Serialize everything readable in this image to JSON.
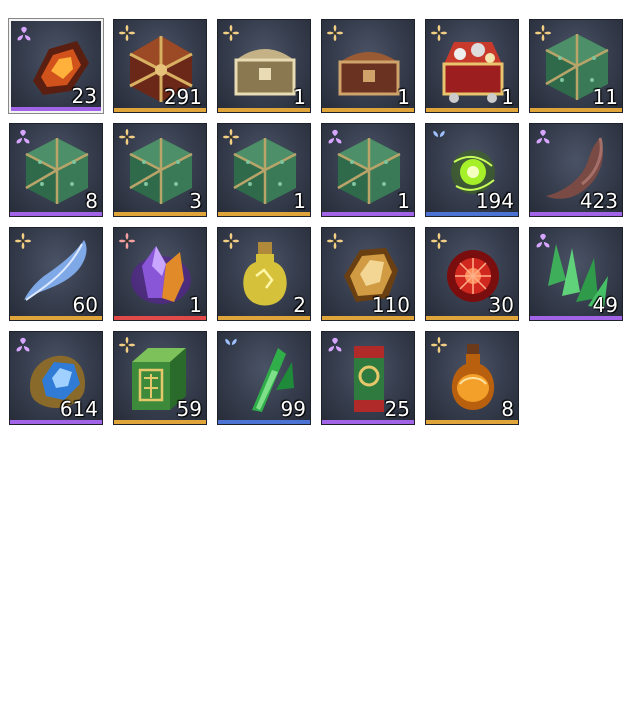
{
  "inventory": {
    "items": [
      {
        "name": "fire-ore-icon",
        "qty": "23",
        "rarity": "epic",
        "selected": true
      },
      {
        "name": "ornate-chest-icon",
        "qty": "291",
        "rarity": "legendary"
      },
      {
        "name": "silver-chest-icon",
        "qty": "1",
        "rarity": "legendary"
      },
      {
        "name": "bronze-chest-icon",
        "qty": "1",
        "rarity": "legendary"
      },
      {
        "name": "treasure-chest-icon",
        "qty": "1",
        "rarity": "legendary"
      },
      {
        "name": "jade-polyhedron-box-icon",
        "qty": "11",
        "rarity": "legendary"
      },
      {
        "name": "jade-polyhedron-box-icon",
        "qty": "8",
        "rarity": "epic"
      },
      {
        "name": "jade-polyhedron-box-icon",
        "qty": "3",
        "rarity": "legendary"
      },
      {
        "name": "jade-polyhedron-box-icon",
        "qty": "1",
        "rarity": "legendary"
      },
      {
        "name": "jade-polyhedron-box-icon",
        "qty": "1",
        "rarity": "epic"
      },
      {
        "name": "green-energy-orb-icon",
        "qty": "194",
        "rarity": "rare"
      },
      {
        "name": "claw-fang-icon",
        "qty": "423",
        "rarity": "epic"
      },
      {
        "name": "blue-feather-icon",
        "qty": "60",
        "rarity": "legendary"
      },
      {
        "name": "purple-crystal-icon",
        "qty": "1",
        "rarity": "mythic"
      },
      {
        "name": "yellow-potion-bottle-icon",
        "qty": "2",
        "rarity": "legendary"
      },
      {
        "name": "amber-stone-icon",
        "qty": "110",
        "rarity": "legendary"
      },
      {
        "name": "red-orb-icon",
        "qty": "30",
        "rarity": "legendary"
      },
      {
        "name": "green-crystal-cluster-icon",
        "qty": "49",
        "rarity": "epic"
      },
      {
        "name": "blue-gem-icon",
        "qty": "614",
        "rarity": "epic"
      },
      {
        "name": "jade-cube-icon",
        "qty": "59",
        "rarity": "legendary"
      },
      {
        "name": "green-shard-icon",
        "qty": "99",
        "rarity": "rare"
      },
      {
        "name": "jade-tablet-icon",
        "qty": "25",
        "rarity": "epic"
      },
      {
        "name": "amber-flask-icon",
        "qty": "8",
        "rarity": "legendary"
      }
    ]
  },
  "rarity_colors": {
    "rare": {
      "bar": "#4a73d4",
      "icon": "#9fc2ff",
      "icon_name": "rare-wing-icon"
    },
    "epic": {
      "bar": "#a164e6",
      "icon": "#d7a6ff",
      "icon_name": "epic-flower-icon"
    },
    "legendary": {
      "bar": "#e0a53a",
      "icon": "#f3cf86",
      "icon_name": "legendary-flower-icon"
    },
    "mythic": {
      "bar": "#e24a4a",
      "icon": "#f5a0a0",
      "icon_name": "mythic-flower-icon"
    }
  }
}
